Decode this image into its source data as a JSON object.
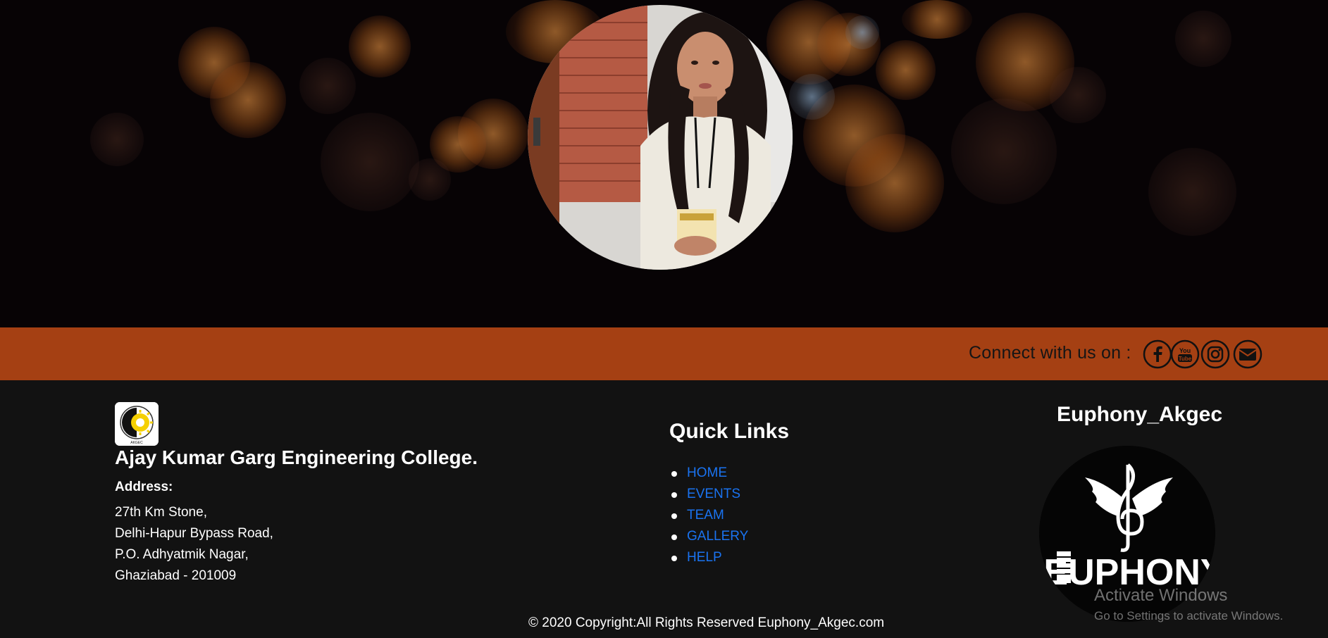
{
  "connect": {
    "label": "Connect with us on :",
    "icons": [
      "facebook-icon",
      "youtube-icon",
      "instagram-icon",
      "envelope-icon"
    ],
    "youtube_text": "You Tube"
  },
  "college": {
    "name": "Ajay Kumar Garg Engineering College.",
    "address_label": "Address:",
    "address_lines": [
      "27th Km Stone,",
      "Delhi-Hapur Bypass Road,",
      "P.O. Adhyatmik Nagar,",
      "Ghaziabad - 201009"
    ],
    "logo_text": "AKGEC"
  },
  "quick_links": {
    "title": "Quick Links",
    "items": [
      "HOME",
      "EVENTS",
      "TEAM",
      "GALLERY",
      "HELP"
    ]
  },
  "euphony": {
    "title": "Euphony_Akgec",
    "logo_text": "EUPHONY"
  },
  "copyright": "© 2020 Copyright:All Rights Reserved Euphony_Akgec.com",
  "windows_watermark": {
    "title": "Activate Windows",
    "subtitle": "Go to Settings to activate Windows."
  },
  "colors": {
    "connect_bar": "#a54013",
    "footer_bg": "#121212",
    "link": "#1a73f0",
    "hero_bg": "#070305"
  }
}
